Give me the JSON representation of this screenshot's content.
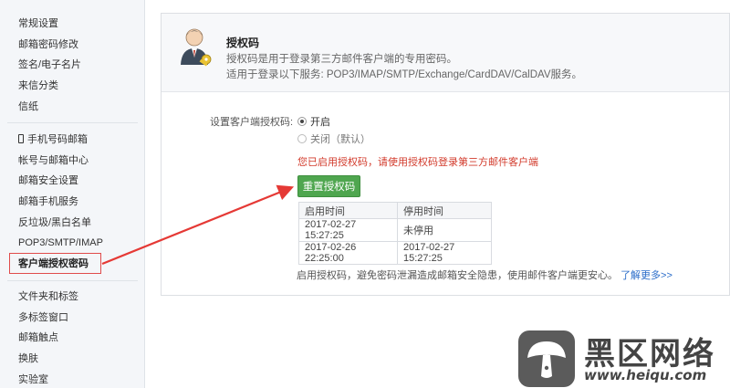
{
  "sidebar": {
    "group1": [
      "常规设置",
      "邮箱密码修改",
      "签名/电子名片",
      "来信分类",
      "信纸"
    ],
    "group2": [
      "手机号码邮箱",
      "帐号与邮箱中心",
      "邮箱安全设置",
      "邮箱手机服务",
      "反垃圾/黑白名单",
      "POP3/SMTP/IMAP",
      "客户端授权密码"
    ],
    "group3": [
      "文件夹和标签",
      "多标签窗口",
      "邮箱触点",
      "换肤",
      "实验室"
    ]
  },
  "panel": {
    "title": "授权码",
    "description": "授权码是用于登录第三方邮件客户端的专用密码。",
    "services": "适用于登录以下服务: POP3/IMAP/SMTP/Exchange/CardDAV/CalDAV服务。",
    "setting_label": "设置客户端授权码:",
    "option_on": "开启",
    "option_off": "关闭（默认）",
    "notice": "您已启用授权码，请使用授权码登录第三方邮件客户端",
    "reset_button": "重置授权码",
    "table": {
      "headers": [
        "启用时间",
        "停用时间"
      ],
      "rows": [
        [
          "2017-02-27 15:27:25",
          "未停用"
        ],
        [
          "2017-02-26 22:25:00",
          "2017-02-27 15:27:25"
        ]
      ]
    },
    "footer_text": "启用授权码，避免密码泄漏造成邮箱安全隐患，使用邮件客户端更安心。",
    "learn_more": "了解更多>>"
  },
  "watermark": {
    "title": "黑区网络",
    "url": "www.heiqu.com"
  },
  "colors": {
    "accent_green": "#4fa64f",
    "notice_red": "#d23a2b",
    "link_blue": "#2a6cc9",
    "arrow_red": "#e53935"
  }
}
